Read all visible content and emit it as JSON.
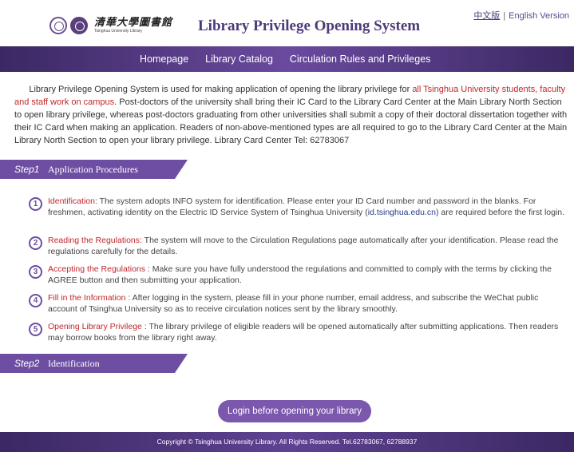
{
  "header": {
    "logo_cn": "清華大學圖書館",
    "logo_en": "Tsinghua University Library",
    "title": "Library Privilege Opening System",
    "lang_cn": "中文版",
    "lang_sep": "|",
    "lang_en": "English Version"
  },
  "nav": {
    "items": [
      "Homepage",
      "Library Catalog",
      "Circulation Rules and Privileges"
    ]
  },
  "intro": {
    "part1": "Library Privilege Opening System is used for making application of opening the library privilege for ",
    "highlight": "all Tsinghua University students, faculty and staff work on campus",
    "part2": ". Post-doctors of the university shall bring their IC Card to the Library Card Center at the Main Library North Section to open library privilege, whereas post-doctors graduating from other universities shall submit a copy of their doctoral dissertation together with their IC Card when making an application. Readers of non-above-mentioned types are all required to go to the Library Card Center at the Main Library North Section to open your library privilege. Library Card Center Tel: 62783067"
  },
  "step1": {
    "num": "Step1",
    "label": "Application Procedures"
  },
  "step2": {
    "num": "Step2",
    "label": "Identification"
  },
  "procedures": [
    {
      "num": "1",
      "title": "Identification:",
      "text_a": " The system adopts INFO system for identification. Please enter your ID Card number and password in the blanks. For freshmen, activating identity on the Electric ID Service System of Tsinghua University (",
      "link": "id.tsinghua.edu.cn",
      "text_b": ") are required before the first login."
    },
    {
      "num": "2",
      "title": "Reading the Regulations:",
      "text_a": " The system will move to the Circulation Regulations page automatically after your identification. Please read the regulations carefully for the details."
    },
    {
      "num": "3",
      "title": "Accepting the Regulations",
      "text_a": " : Make sure you have fully understood the regulations and committed to comply with the terms by clicking the AGREE button and then submitting your application."
    },
    {
      "num": "4",
      "title": "Fill in the Information",
      "text_a": " : After logging in the system, please fill in your phone number, email address, and subscribe the WeChat public account of Tsinghua University so as to receive circulation notices sent by the library smoothly."
    },
    {
      "num": "5",
      "title": "Opening Library Privilege",
      "text_a": " : The library privilege of eligible readers will be opened automatically after submitting applications. Then readers may borrow books from the library right away."
    }
  ],
  "login_button": "Login before opening your library",
  "footer": "Copyright © Tsinghua University Library. All Rights Reserved. Tel.62783067, 62788937"
}
